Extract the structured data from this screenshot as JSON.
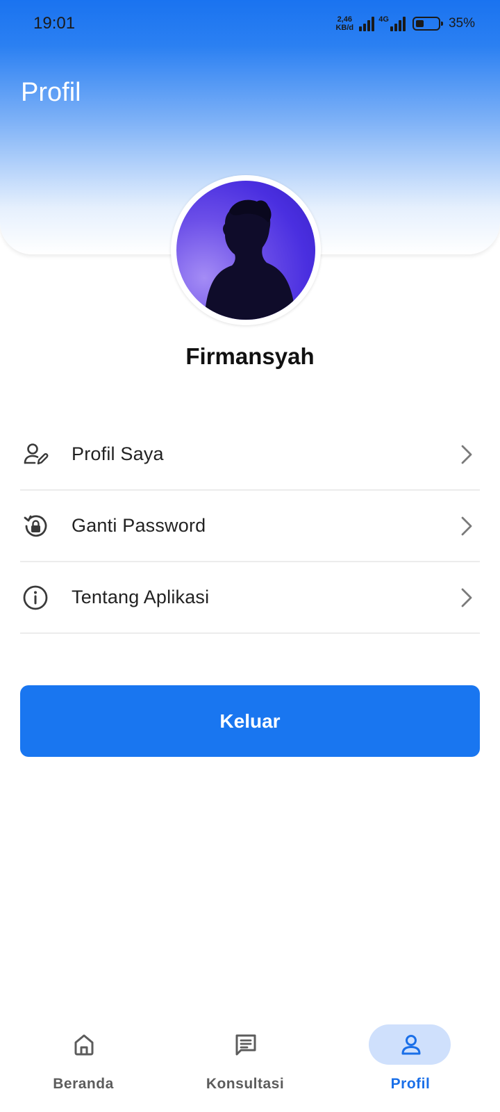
{
  "status_bar": {
    "time": "19:01",
    "net_speed_value": "2,46",
    "net_speed_unit": "KB/d",
    "network_type": "4G",
    "battery_percent": 35,
    "battery_text": "35%"
  },
  "header": {
    "title": "Profil"
  },
  "profile": {
    "name": "Firmansyah",
    "avatar_icon": "person-silhouette-photo"
  },
  "menu": {
    "items": [
      {
        "label": "Profil Saya",
        "icon": "user-edit-icon"
      },
      {
        "label": "Ganti Password",
        "icon": "lock-reset-icon"
      },
      {
        "label": "Tentang Aplikasi",
        "icon": "info-icon"
      }
    ]
  },
  "logout": {
    "label": "Keluar"
  },
  "bottom_nav": {
    "items": [
      {
        "label": "Beranda",
        "icon": "home-icon",
        "active": false
      },
      {
        "label": "Konsultasi",
        "icon": "chat-icon",
        "active": false
      },
      {
        "label": "Profil",
        "icon": "person-icon",
        "active": true
      }
    ]
  },
  "colors": {
    "primary": "#1976f0",
    "active_nav_pill": "#cfe0fc",
    "active_nav_text": "#1a6fe8"
  }
}
